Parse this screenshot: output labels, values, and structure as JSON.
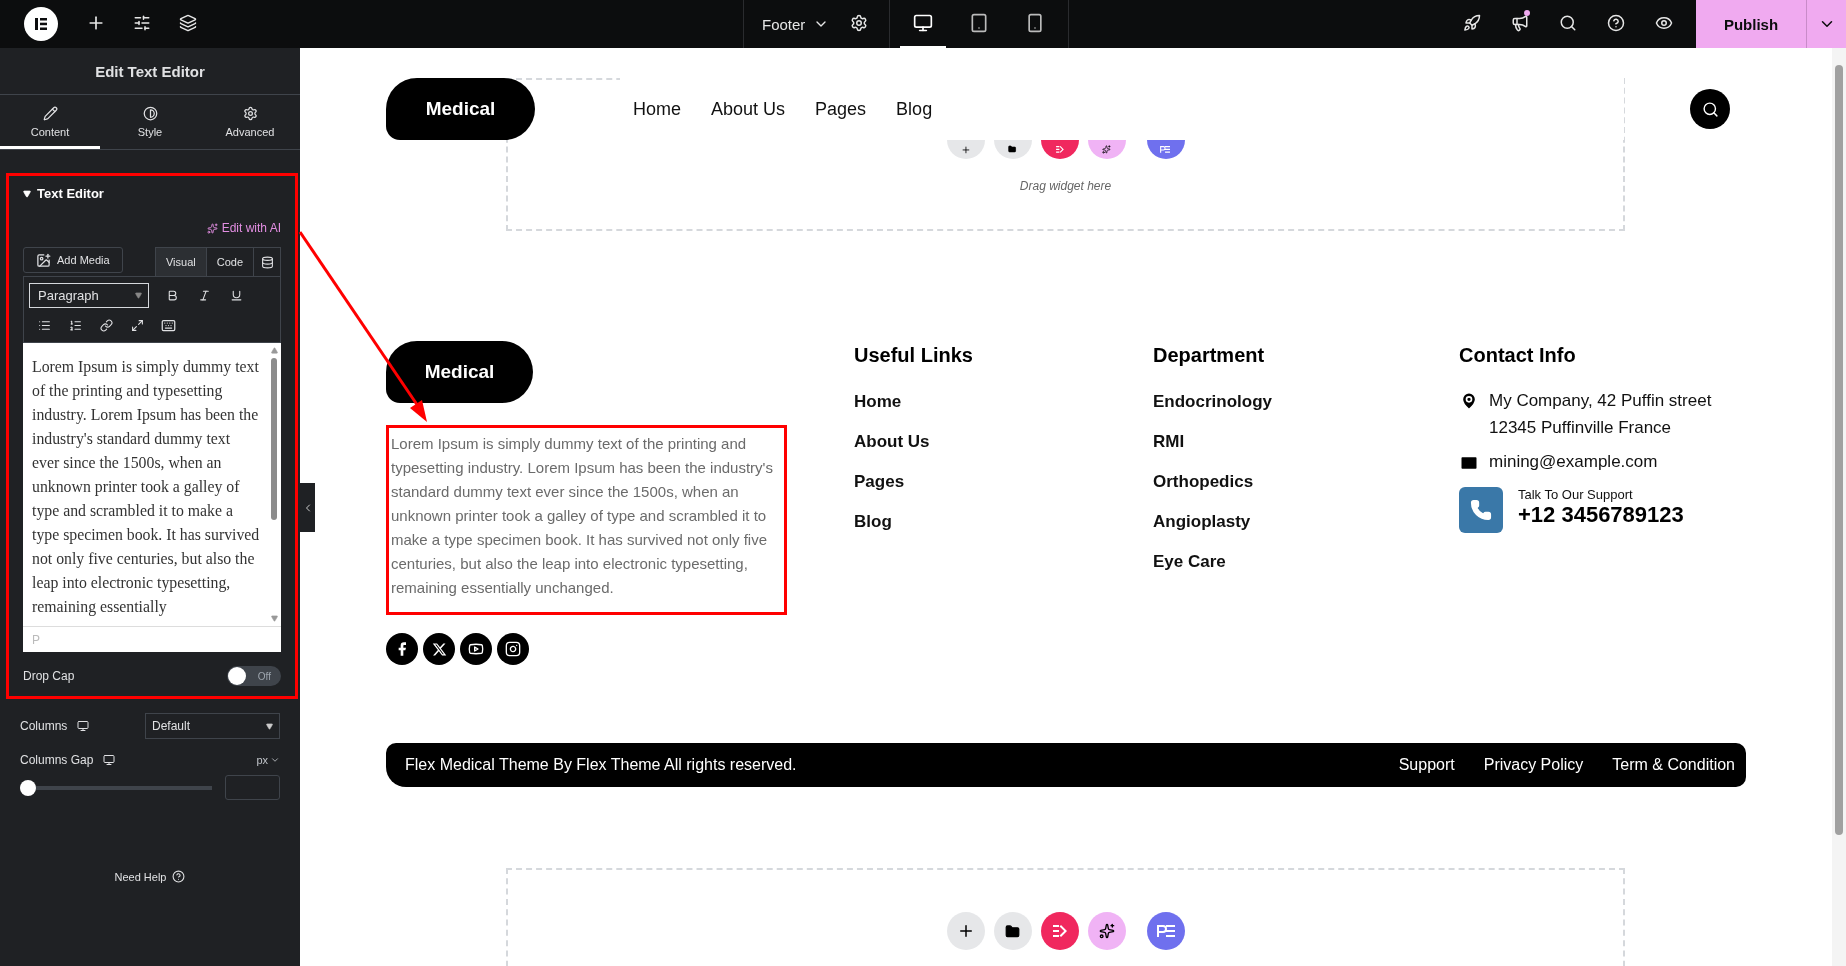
{
  "topbar": {
    "document": "Footer",
    "devices": [
      {
        "kind": "desktop",
        "selected": true
      },
      {
        "kind": "tablet",
        "selected": false
      },
      {
        "kind": "mobile",
        "selected": false
      }
    ],
    "publish": "Publish"
  },
  "panel": {
    "title": "Edit Text Editor",
    "tabs": [
      {
        "label": "Content",
        "kind": "content",
        "selected": true
      },
      {
        "label": "Style",
        "kind": "style",
        "selected": false
      },
      {
        "label": "Advanced",
        "kind": "advanced",
        "selected": false
      }
    ],
    "section": {
      "title": "Text Editor",
      "expanded": true,
      "ai_link": "Edit with AI",
      "add_media": "Add Media",
      "modes": [
        {
          "label": "Visual",
          "selected": true
        },
        {
          "label": "Code",
          "selected": false
        }
      ],
      "format": "Paragraph",
      "editor_text": "Lorem Ipsum is simply dummy text of the printing and typesetting industry. Lorem Ipsum has been the industry's standard dummy text ever since the 1500s, when an unknown printer took a galley of type and scrambled it to make a type specimen book. It has survived not only five centuries, but also the leap into electronic typesetting, remaining essentially",
      "path": "P",
      "drop_cap": {
        "label": "Drop Cap",
        "state_text": "Off",
        "on": false
      }
    },
    "columns": {
      "label": "Columns",
      "value": "Default"
    },
    "columns_gap": {
      "label": "Columns Gap",
      "unit": "px",
      "level": 0
    },
    "help": "Need Help"
  },
  "canvas": {
    "drop_hint": "Drag widget here",
    "header": {
      "logo": "Medical",
      "nav": [
        "Home",
        "About Us",
        "Pages",
        "Blog"
      ]
    },
    "footer": {
      "logo": "Medical",
      "about": "Lorem Ipsum is simply dummy text of the printing and typesetting industry. Lorem Ipsum has been the industry's standard dummy text ever since the 1500s, when an unknown printer took a galley of type and scrambled it to make a type specimen book. It has survived not only five centuries, but also the leap into electronic typesetting, remaining essentially unchanged.",
      "columns": [
        {
          "title": "Useful Links",
          "links": [
            "Home",
            "About Us",
            "Pages",
            "Blog"
          ]
        },
        {
          "title": "Department",
          "links": [
            "Endocrinology",
            "RMI",
            "Orthopedics",
            "Angioplasty",
            "Eye Care"
          ]
        }
      ],
      "contact": {
        "title": "Contact Info",
        "address": "My Company, 42 Puffin street 12345 Puffinville France",
        "email": "mining@example.com",
        "support_label": "Talk To Our Support",
        "phone": "+12 3456789123"
      },
      "copyright": "Flex Medical Theme By Flex Theme All rights reserved.",
      "legal_links": [
        "Support",
        "Privacy Policy",
        "Term & Condition"
      ]
    }
  }
}
